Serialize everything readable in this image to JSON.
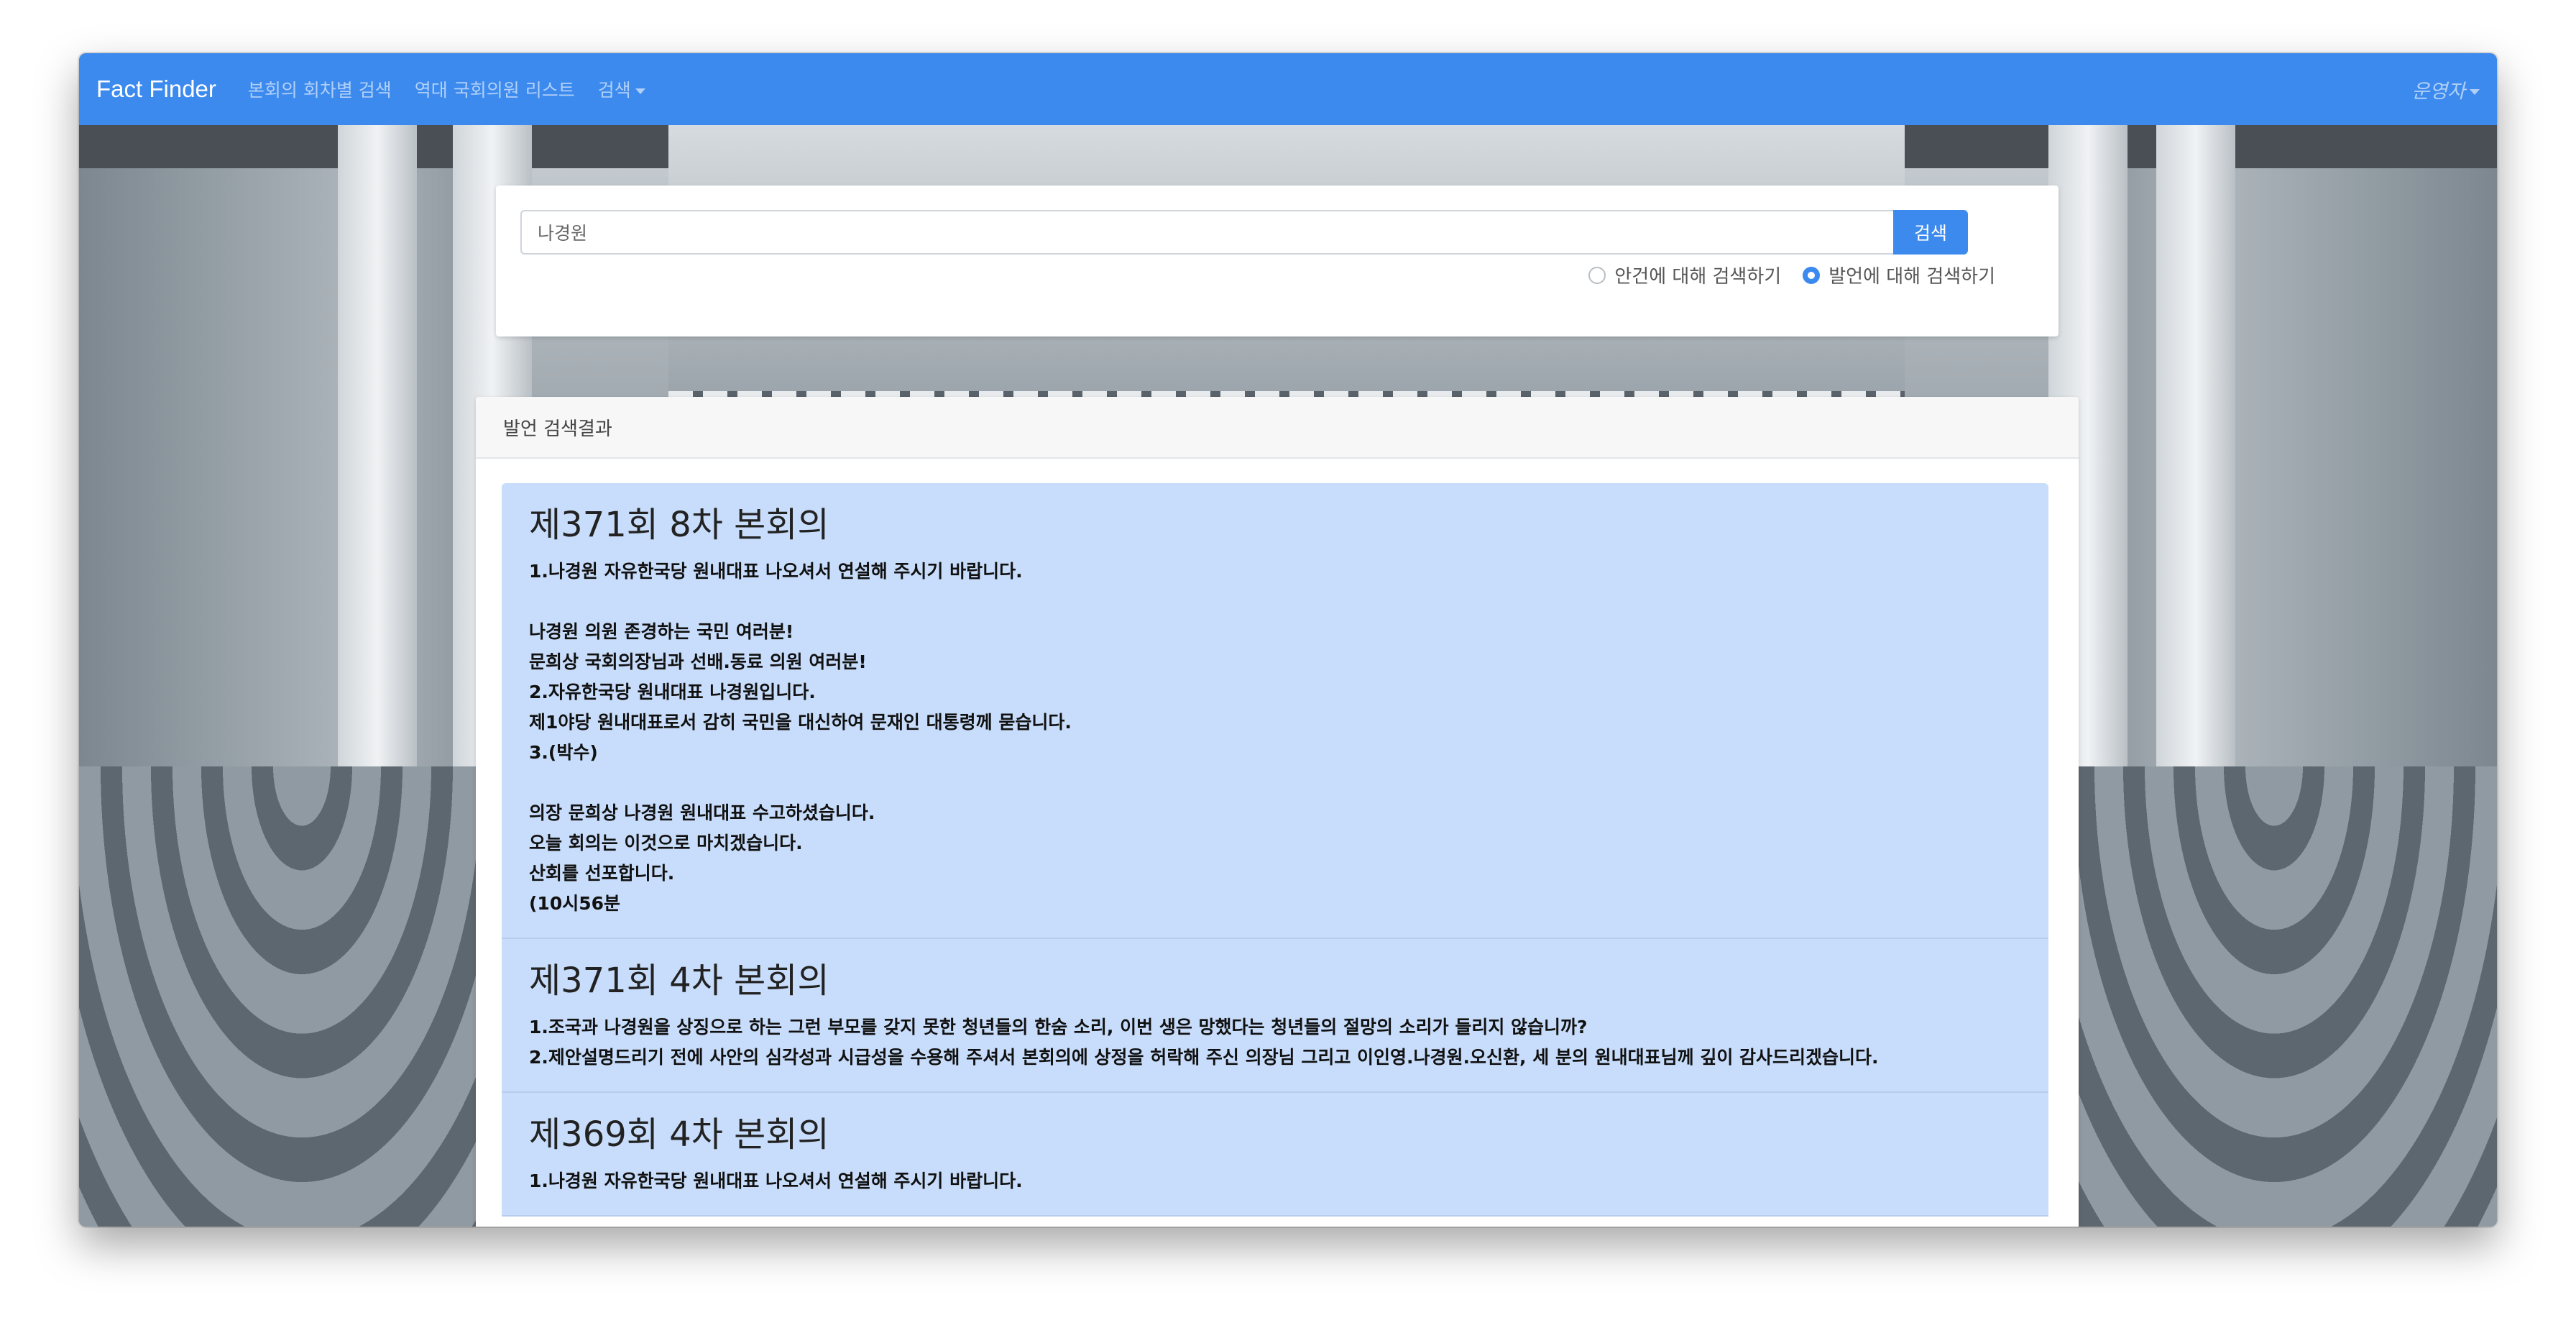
{
  "navbar": {
    "brand": "Fact Finder",
    "links": [
      "본회의 회차별 검색",
      "역대 국회의원 리스트",
      "검색"
    ],
    "user": "운영자"
  },
  "search": {
    "value": "나경원",
    "button": "검색",
    "options": [
      {
        "label": "안건에 대해 검색하기",
        "checked": false
      },
      {
        "label": "발언에 대해 검색하기",
        "checked": true
      }
    ]
  },
  "results": {
    "header": "발언 검색결과",
    "items": [
      {
        "title": "제371회 8차 본회의",
        "lines": [
          "1.나경원 자유한국당 원내대표 나오셔서 연설해 주시기 바랍니다.",
          "",
          "나경원 의원 존경하는 국민 여러분!",
          "문희상 국회의장님과 선배.동료 의원 여러분!",
          "2.자유한국당 원내대표 나경원입니다.",
          "제1야당 원내대표로서 감히 국민을 대신하여 문재인 대통령께 묻습니다.",
          "3.(박수)",
          "",
          "의장 문희상 나경원 원내대표 수고하셨습니다.",
          "오늘 회의는 이것으로 마치겠습니다.",
          "산회를 선포합니다.",
          "(10시56분"
        ]
      },
      {
        "title": "제371회 4차 본회의",
        "lines": [
          "1.조국과 나경원을 상징으로 하는 그런 부모를 갖지 못한 청년들의 한숨 소리, 이번 생은 망했다는 청년들의 절망의 소리가 들리지 않습니까?",
          "2.제안설명드리기 전에 사안의 심각성과 시급성을 수용해 주셔서 본회의에 상정을 허락해 주신 의장님 그리고 이인영.나경원.오신환, 세 분의 원내대표님께 깊이 감사드리겠습니다."
        ]
      },
      {
        "title": "제369회 4차 본회의",
        "lines": [
          "1.나경원 자유한국당 원내대표 나오셔서 연설해 주시기 바랍니다."
        ]
      }
    ]
  },
  "colors": {
    "navbar": "#3c8aee",
    "result_bg": "#c8ddfb",
    "button": "#3c8aee"
  }
}
